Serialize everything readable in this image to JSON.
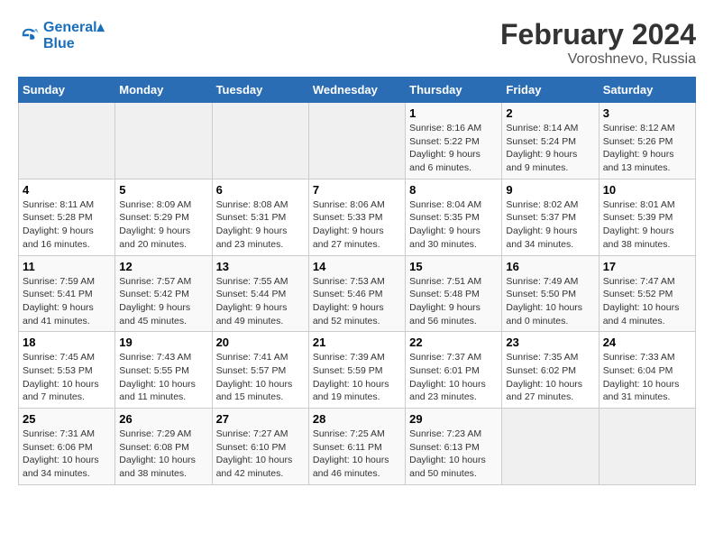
{
  "logo": {
    "line1": "General",
    "line2": "Blue"
  },
  "title": "February 2024",
  "subtitle": "Voroshnevo, Russia",
  "days_of_week": [
    "Sunday",
    "Monday",
    "Tuesday",
    "Wednesday",
    "Thursday",
    "Friday",
    "Saturday"
  ],
  "weeks": [
    [
      {
        "day": "",
        "info": ""
      },
      {
        "day": "",
        "info": ""
      },
      {
        "day": "",
        "info": ""
      },
      {
        "day": "",
        "info": ""
      },
      {
        "day": "1",
        "info": "Sunrise: 8:16 AM\nSunset: 5:22 PM\nDaylight: 9 hours and 6 minutes."
      },
      {
        "day": "2",
        "info": "Sunrise: 8:14 AM\nSunset: 5:24 PM\nDaylight: 9 hours and 9 minutes."
      },
      {
        "day": "3",
        "info": "Sunrise: 8:12 AM\nSunset: 5:26 PM\nDaylight: 9 hours and 13 minutes."
      }
    ],
    [
      {
        "day": "4",
        "info": "Sunrise: 8:11 AM\nSunset: 5:28 PM\nDaylight: 9 hours and 16 minutes."
      },
      {
        "day": "5",
        "info": "Sunrise: 8:09 AM\nSunset: 5:29 PM\nDaylight: 9 hours and 20 minutes."
      },
      {
        "day": "6",
        "info": "Sunrise: 8:08 AM\nSunset: 5:31 PM\nDaylight: 9 hours and 23 minutes."
      },
      {
        "day": "7",
        "info": "Sunrise: 8:06 AM\nSunset: 5:33 PM\nDaylight: 9 hours and 27 minutes."
      },
      {
        "day": "8",
        "info": "Sunrise: 8:04 AM\nSunset: 5:35 PM\nDaylight: 9 hours and 30 minutes."
      },
      {
        "day": "9",
        "info": "Sunrise: 8:02 AM\nSunset: 5:37 PM\nDaylight: 9 hours and 34 minutes."
      },
      {
        "day": "10",
        "info": "Sunrise: 8:01 AM\nSunset: 5:39 PM\nDaylight: 9 hours and 38 minutes."
      }
    ],
    [
      {
        "day": "11",
        "info": "Sunrise: 7:59 AM\nSunset: 5:41 PM\nDaylight: 9 hours and 41 minutes."
      },
      {
        "day": "12",
        "info": "Sunrise: 7:57 AM\nSunset: 5:42 PM\nDaylight: 9 hours and 45 minutes."
      },
      {
        "day": "13",
        "info": "Sunrise: 7:55 AM\nSunset: 5:44 PM\nDaylight: 9 hours and 49 minutes."
      },
      {
        "day": "14",
        "info": "Sunrise: 7:53 AM\nSunset: 5:46 PM\nDaylight: 9 hours and 52 minutes."
      },
      {
        "day": "15",
        "info": "Sunrise: 7:51 AM\nSunset: 5:48 PM\nDaylight: 9 hours and 56 minutes."
      },
      {
        "day": "16",
        "info": "Sunrise: 7:49 AM\nSunset: 5:50 PM\nDaylight: 10 hours and 0 minutes."
      },
      {
        "day": "17",
        "info": "Sunrise: 7:47 AM\nSunset: 5:52 PM\nDaylight: 10 hours and 4 minutes."
      }
    ],
    [
      {
        "day": "18",
        "info": "Sunrise: 7:45 AM\nSunset: 5:53 PM\nDaylight: 10 hours and 7 minutes."
      },
      {
        "day": "19",
        "info": "Sunrise: 7:43 AM\nSunset: 5:55 PM\nDaylight: 10 hours and 11 minutes."
      },
      {
        "day": "20",
        "info": "Sunrise: 7:41 AM\nSunset: 5:57 PM\nDaylight: 10 hours and 15 minutes."
      },
      {
        "day": "21",
        "info": "Sunrise: 7:39 AM\nSunset: 5:59 PM\nDaylight: 10 hours and 19 minutes."
      },
      {
        "day": "22",
        "info": "Sunrise: 7:37 AM\nSunset: 6:01 PM\nDaylight: 10 hours and 23 minutes."
      },
      {
        "day": "23",
        "info": "Sunrise: 7:35 AM\nSunset: 6:02 PM\nDaylight: 10 hours and 27 minutes."
      },
      {
        "day": "24",
        "info": "Sunrise: 7:33 AM\nSunset: 6:04 PM\nDaylight: 10 hours and 31 minutes."
      }
    ],
    [
      {
        "day": "25",
        "info": "Sunrise: 7:31 AM\nSunset: 6:06 PM\nDaylight: 10 hours and 34 minutes."
      },
      {
        "day": "26",
        "info": "Sunrise: 7:29 AM\nSunset: 6:08 PM\nDaylight: 10 hours and 38 minutes."
      },
      {
        "day": "27",
        "info": "Sunrise: 7:27 AM\nSunset: 6:10 PM\nDaylight: 10 hours and 42 minutes."
      },
      {
        "day": "28",
        "info": "Sunrise: 7:25 AM\nSunset: 6:11 PM\nDaylight: 10 hours and 46 minutes."
      },
      {
        "day": "29",
        "info": "Sunrise: 7:23 AM\nSunset: 6:13 PM\nDaylight: 10 hours and 50 minutes."
      },
      {
        "day": "",
        "info": ""
      },
      {
        "day": "",
        "info": ""
      }
    ]
  ]
}
